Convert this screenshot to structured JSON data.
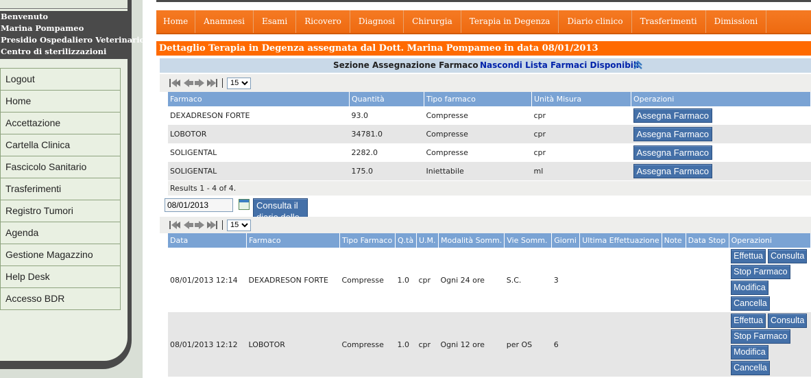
{
  "sidebar": {
    "welcome": [
      "Benvenuto",
      "Marina Pompameo",
      "Presidio Ospedaliero Veterinario",
      "Centro di sterilizzazioni"
    ],
    "menu": [
      "Logout",
      "Home",
      "Accettazione",
      "Cartella Clinica",
      "Fascicolo Sanitario",
      "Trasferimenti",
      "Registro Tumori",
      "Agenda",
      "Gestione Magazzino",
      "Help Desk",
      "Accesso BDR"
    ]
  },
  "nav": {
    "tabs": [
      "Home",
      "Anamnesi",
      "Esami",
      "Ricovero",
      "Diagnosi",
      "Chirurgia",
      "Terapia in Degenza",
      "Diario clinico",
      "Trasferimenti",
      "Dimissioni"
    ]
  },
  "page": {
    "title": "Dettaglio Terapia in Degenza assegnata dal Dott. Marina Pompameo in data 08/01/2013",
    "section_label": "Sezione Assegnazione Farmaco",
    "hide_link": "Nascondi Lista Farmaci Disponibili"
  },
  "pager": {
    "page_size": "15",
    "nav_arrows": [
      "⏮",
      "◀",
      "▶",
      "⏭"
    ]
  },
  "farmaci": {
    "headers": [
      "Farmaco",
      "Quantità",
      "Tipo farmaco",
      "Unità Misura",
      "Operazioni"
    ],
    "rows": [
      {
        "farmaco": "DEXADRESON FORTE",
        "quantita": "93.0",
        "tipo": "Compresse",
        "unita": "cpr",
        "op": "Assegna Farmaco"
      },
      {
        "farmaco": "LOBOTOR",
        "quantita": "34781.0",
        "tipo": "Compresse",
        "unita": "cpr",
        "op": "Assegna Farmaco"
      },
      {
        "farmaco": "SOLIGENTAL",
        "quantita": "2282.0",
        "tipo": "Compresse",
        "unita": "cpr",
        "op": "Assegna Farmaco"
      },
      {
        "farmaco": "SOLIGENTAL",
        "quantita": "175.0",
        "tipo": "Iniettabile",
        "unita": "ml",
        "op": "Assegna Farmaco"
      }
    ],
    "results": "Results 1 - 4 of 4."
  },
  "diario": {
    "date_value": "08/01/2013",
    "consult_button": "Consulta il diario delle effettuazioni per data",
    "headers": [
      "Data",
      "Farmaco",
      "Tipo Farmaco",
      "Q.tà",
      "U.M.",
      "Modalità Somm.",
      "Vie Somm.",
      "Giorni",
      "Ultima Effettuazione",
      "Note",
      "Data Stop",
      "Operazioni"
    ],
    "rows": [
      {
        "data": "08/01/2013 12:14",
        "farmaco": "DEXADRESON FORTE",
        "tipo": "Compresse",
        "qta": "1.0",
        "um": "cpr",
        "modalita": "Ogni 24 ore",
        "vie": "S.C.",
        "giorni": "3",
        "ultima": "",
        "note": "",
        "stop": ""
      },
      {
        "data": "08/01/2013 12:12",
        "farmaco": "LOBOTOR",
        "tipo": "Compresse",
        "qta": "1.0",
        "um": "cpr",
        "modalita": "Ogni 12 ore",
        "vie": "per OS",
        "giorni": "6",
        "ultima": "",
        "note": "",
        "stop": ""
      }
    ],
    "op_buttons": {
      "effettua": "Effettua",
      "consulta": "Consulta",
      "stop": "Stop Farmaco",
      "modifica": "Modifica",
      "cancella": "Cancella"
    }
  }
}
